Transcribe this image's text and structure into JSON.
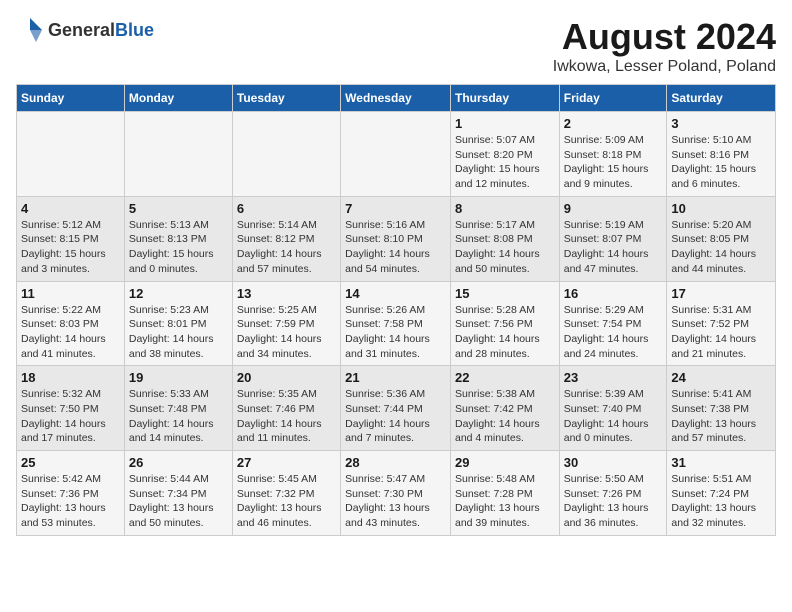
{
  "logo": {
    "text_general": "General",
    "text_blue": "Blue"
  },
  "title": "August 2024",
  "subtitle": "Iwkowa, Lesser Poland, Poland",
  "days_of_week": [
    "Sunday",
    "Monday",
    "Tuesday",
    "Wednesday",
    "Thursday",
    "Friday",
    "Saturday"
  ],
  "weeks": [
    [
      {
        "day": "",
        "info": ""
      },
      {
        "day": "",
        "info": ""
      },
      {
        "day": "",
        "info": ""
      },
      {
        "day": "",
        "info": ""
      },
      {
        "day": "1",
        "info": "Sunrise: 5:07 AM\nSunset: 8:20 PM\nDaylight: 15 hours and 12 minutes."
      },
      {
        "day": "2",
        "info": "Sunrise: 5:09 AM\nSunset: 8:18 PM\nDaylight: 15 hours and 9 minutes."
      },
      {
        "day": "3",
        "info": "Sunrise: 5:10 AM\nSunset: 8:16 PM\nDaylight: 15 hours and 6 minutes."
      }
    ],
    [
      {
        "day": "4",
        "info": "Sunrise: 5:12 AM\nSunset: 8:15 PM\nDaylight: 15 hours and 3 minutes."
      },
      {
        "day": "5",
        "info": "Sunrise: 5:13 AM\nSunset: 8:13 PM\nDaylight: 15 hours and 0 minutes."
      },
      {
        "day": "6",
        "info": "Sunrise: 5:14 AM\nSunset: 8:12 PM\nDaylight: 14 hours and 57 minutes."
      },
      {
        "day": "7",
        "info": "Sunrise: 5:16 AM\nSunset: 8:10 PM\nDaylight: 14 hours and 54 minutes."
      },
      {
        "day": "8",
        "info": "Sunrise: 5:17 AM\nSunset: 8:08 PM\nDaylight: 14 hours and 50 minutes."
      },
      {
        "day": "9",
        "info": "Sunrise: 5:19 AM\nSunset: 8:07 PM\nDaylight: 14 hours and 47 minutes."
      },
      {
        "day": "10",
        "info": "Sunrise: 5:20 AM\nSunset: 8:05 PM\nDaylight: 14 hours and 44 minutes."
      }
    ],
    [
      {
        "day": "11",
        "info": "Sunrise: 5:22 AM\nSunset: 8:03 PM\nDaylight: 14 hours and 41 minutes."
      },
      {
        "day": "12",
        "info": "Sunrise: 5:23 AM\nSunset: 8:01 PM\nDaylight: 14 hours and 38 minutes."
      },
      {
        "day": "13",
        "info": "Sunrise: 5:25 AM\nSunset: 7:59 PM\nDaylight: 14 hours and 34 minutes."
      },
      {
        "day": "14",
        "info": "Sunrise: 5:26 AM\nSunset: 7:58 PM\nDaylight: 14 hours and 31 minutes."
      },
      {
        "day": "15",
        "info": "Sunrise: 5:28 AM\nSunset: 7:56 PM\nDaylight: 14 hours and 28 minutes."
      },
      {
        "day": "16",
        "info": "Sunrise: 5:29 AM\nSunset: 7:54 PM\nDaylight: 14 hours and 24 minutes."
      },
      {
        "day": "17",
        "info": "Sunrise: 5:31 AM\nSunset: 7:52 PM\nDaylight: 14 hours and 21 minutes."
      }
    ],
    [
      {
        "day": "18",
        "info": "Sunrise: 5:32 AM\nSunset: 7:50 PM\nDaylight: 14 hours and 17 minutes."
      },
      {
        "day": "19",
        "info": "Sunrise: 5:33 AM\nSunset: 7:48 PM\nDaylight: 14 hours and 14 minutes."
      },
      {
        "day": "20",
        "info": "Sunrise: 5:35 AM\nSunset: 7:46 PM\nDaylight: 14 hours and 11 minutes."
      },
      {
        "day": "21",
        "info": "Sunrise: 5:36 AM\nSunset: 7:44 PM\nDaylight: 14 hours and 7 minutes."
      },
      {
        "day": "22",
        "info": "Sunrise: 5:38 AM\nSunset: 7:42 PM\nDaylight: 14 hours and 4 minutes."
      },
      {
        "day": "23",
        "info": "Sunrise: 5:39 AM\nSunset: 7:40 PM\nDaylight: 14 hours and 0 minutes."
      },
      {
        "day": "24",
        "info": "Sunrise: 5:41 AM\nSunset: 7:38 PM\nDaylight: 13 hours and 57 minutes."
      }
    ],
    [
      {
        "day": "25",
        "info": "Sunrise: 5:42 AM\nSunset: 7:36 PM\nDaylight: 13 hours and 53 minutes."
      },
      {
        "day": "26",
        "info": "Sunrise: 5:44 AM\nSunset: 7:34 PM\nDaylight: 13 hours and 50 minutes."
      },
      {
        "day": "27",
        "info": "Sunrise: 5:45 AM\nSunset: 7:32 PM\nDaylight: 13 hours and 46 minutes."
      },
      {
        "day": "28",
        "info": "Sunrise: 5:47 AM\nSunset: 7:30 PM\nDaylight: 13 hours and 43 minutes."
      },
      {
        "day": "29",
        "info": "Sunrise: 5:48 AM\nSunset: 7:28 PM\nDaylight: 13 hours and 39 minutes."
      },
      {
        "day": "30",
        "info": "Sunrise: 5:50 AM\nSunset: 7:26 PM\nDaylight: 13 hours and 36 minutes."
      },
      {
        "day": "31",
        "info": "Sunrise: 5:51 AM\nSunset: 7:24 PM\nDaylight: 13 hours and 32 minutes."
      }
    ]
  ]
}
